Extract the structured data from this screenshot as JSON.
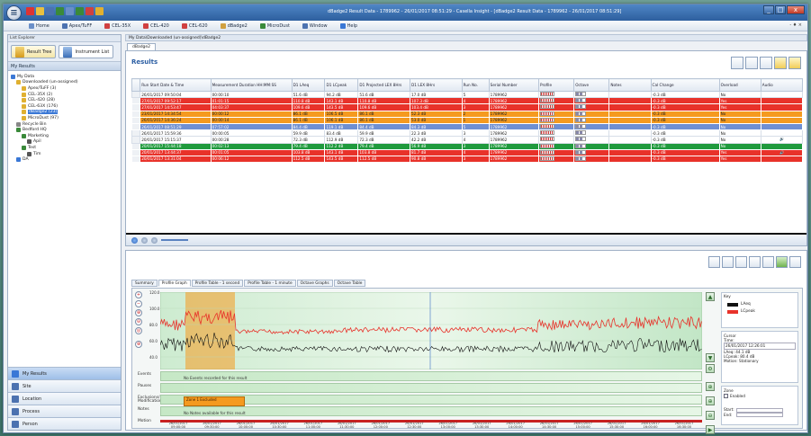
{
  "window": {
    "title": "dBadge2 Result Data - 1789962 - 26/01/2017 08:51:29 - Casella Insight - [dBadge2 Result Data - 1789962 - 26/01/2017 08:51:29]",
    "controls": [
      "_",
      "□",
      "x"
    ]
  },
  "menu": {
    "items": [
      {
        "label": "Home",
        "color": "#6a8fc8"
      },
      {
        "label": "Apex/TuFF",
        "color": "#4c72b0"
      },
      {
        "label": "CEL-35X",
        "color": "#d04040"
      },
      {
        "label": "CEL-420",
        "color": "#d04040"
      },
      {
        "label": "CEL-620",
        "color": "#d04040"
      },
      {
        "label": "dBadge2",
        "color": "#d0a040"
      },
      {
        "label": "MicroDust",
        "color": "#3a8a3a"
      },
      {
        "label": "Window",
        "color": "#4c72b0"
      },
      {
        "label": "Help",
        "color": "#3a78d6"
      }
    ],
    "right": "- ♦ ×"
  },
  "left": {
    "caption": "List Explorer",
    "tabs": [
      {
        "label": "Result Tree",
        "active": true
      },
      {
        "label": "Instrument List",
        "active": false
      }
    ],
    "section": "My Results",
    "tree": [
      {
        "label": "My Data",
        "indent": 0,
        "color": "#3a78d6"
      },
      {
        "label": "Downloaded (un-assigned)",
        "indent": 1,
        "color": "#e0b030"
      },
      {
        "label": "Apex/TuFF (3)",
        "indent": 2,
        "color": "#e0b030"
      },
      {
        "label": "CEL-35X (2)",
        "indent": 2,
        "color": "#e0b030"
      },
      {
        "label": "CEL-420 (28)",
        "indent": 2,
        "color": "#e0b030"
      },
      {
        "label": "CEL-63X (176)",
        "indent": 2,
        "color": "#e0b030"
      },
      {
        "label": "dBadge2 (23)",
        "indent": 2,
        "color": "#e0b030",
        "selected": true
      },
      {
        "label": "MicroDust (97)",
        "indent": 2,
        "color": "#e0b030"
      },
      {
        "label": "Recycle Bin",
        "indent": 1,
        "color": "#888888"
      },
      {
        "label": "Bedford HQ",
        "indent": 1,
        "color": "#3a8a3a"
      },
      {
        "label": "Marketing",
        "indent": 2,
        "color": "#3a8a3a"
      },
      {
        "label": "Apil",
        "indent": 3,
        "color": "#555555"
      },
      {
        "label": "Test",
        "indent": 2,
        "color": "#3a8a3a"
      },
      {
        "label": "Tim",
        "indent": 3,
        "color": "#555555"
      },
      {
        "label": "DA",
        "indent": 1,
        "color": "#3a78d6"
      }
    ],
    "nav": [
      {
        "label": "My Results",
        "active": true,
        "color": "#3a78d6"
      },
      {
        "label": "Site",
        "active": false,
        "color": "#4c72b0"
      },
      {
        "label": "Location",
        "active": false,
        "color": "#4c72b0"
      },
      {
        "label": "Process",
        "active": false,
        "color": "#4c72b0"
      },
      {
        "label": "Person",
        "active": false,
        "color": "#4c72b0"
      }
    ]
  },
  "main": {
    "path": "My Data\\Downloaded (un-assigned)\\dBadge2",
    "doc_tab": "dBadge2",
    "results_title": "Results",
    "columns": [
      "Run Start Date & Time",
      "Measurement Duration HH:MM:SS",
      "D1 LAeq",
      "D1 LCpeak",
      "D1 Projected LEX 8Hrs",
      "D1 LEX 8Hrs",
      "Run No.",
      "Serial Number",
      "Profile",
      "Octave",
      "Notes",
      "Cal Change",
      "Overload",
      "Audio"
    ],
    "rows": [
      {
        "c": "c-white",
        "cells": [
          "26/01/2017 09:50:04",
          "00:00:10",
          "51.6 dB",
          "94.2 dB",
          "51.6 dB",
          "17.0 dB",
          "5",
          "1789962",
          "",
          "",
          "",
          "-0.3 dB",
          "No",
          ""
        ]
      },
      {
        "c": "c-red",
        "cells": [
          "27/01/2017 09:52:17",
          "01:01:15",
          "110.8 dB",
          "143.1 dB",
          "110.8 dB",
          "107.3 dB",
          "4",
          "1789962",
          "",
          "",
          "",
          "-0.3 dB",
          "Yes",
          ""
        ]
      },
      {
        "c": "c-red",
        "cells": [
          "27/01/2017 14:53:47",
          "04:03:37",
          "109.6 dB",
          "143.5 dB",
          "109.6 dB",
          "103.4 dB",
          "3",
          "1789962",
          "",
          "",
          "",
          "-0.3 dB",
          "Yes",
          ""
        ]
      },
      {
        "c": "c-orange",
        "cells": [
          "23/01/2017 14:34:54",
          "00:00:12",
          "86.1 dB",
          "106.5 dB",
          "86.1 dB",
          "52.3 dB",
          "2",
          "1789962",
          "",
          "",
          "",
          "-0.3 dB",
          "No",
          ""
        ]
      },
      {
        "c": "c-orange",
        "cells": [
          "26/01/2017 14:36:24",
          "00:00:14",
          "86.1 dB",
          "106.1 dB",
          "86.1 dB",
          "53.0 dB",
          "1",
          "1789962",
          "",
          "",
          "",
          "-0.3 dB",
          "No",
          ""
        ]
      },
      {
        "c": "c-blue",
        "cells": [
          "26/01/2017 08:51:29",
          "07:57:02",
          "84.4 dB",
          "119.1 dB",
          "84.4 dB",
          "84.3 dB",
          "5",
          "1789962",
          "",
          "",
          "",
          "-0.3 dB",
          "No",
          ""
        ]
      },
      {
        "c": "c-white",
        "cells": [
          "26/01/2017 15:59:36",
          "00:00:05",
          "59.9 dB",
          "83.4 dB",
          "59.9 dB",
          "22.3 dB",
          "3",
          "1789962",
          "",
          "",
          "",
          "-0.3 dB",
          "No",
          ""
        ]
      },
      {
        "c": "c-white",
        "cells": [
          "20/01/2017 15:15:37",
          "00:00:28",
          "72.3 dB",
          "112.9 dB",
          "72.3 dB",
          "42.2 dB",
          "4",
          "1789962",
          "",
          "",
          "",
          "-0.3 dB",
          "No",
          "🔊"
        ]
      },
      {
        "c": "c-green",
        "cells": [
          "20/01/2017 15:44:18",
          "00:02:13",
          "79.4 dB",
          "112.2 dB",
          "79.4 dB",
          "56.9 dB",
          "3",
          "1789962",
          "",
          "",
          "",
          "-0.3 dB",
          "No",
          ""
        ]
      },
      {
        "c": "c-red",
        "cells": [
          "20/01/2017 13:44:37",
          "00:01:05",
          "103.8 dB",
          "143.1 dB",
          "103.8 dB",
          "81.7 dB",
          "4",
          "1789962",
          "",
          "",
          "",
          "-0.3 dB",
          "Yes",
          "🔊"
        ]
      },
      {
        "c": "c-red",
        "cells": [
          "20/01/2017 13:31:04",
          "00:06:12",
          "112.5 dB",
          "143.5 dB",
          "112.5 dB",
          "90.8 dB",
          "3",
          "1789962",
          "",
          "",
          "",
          "-0.3 dB",
          "Yes",
          ""
        ]
      }
    ],
    "lower": {
      "tabs": [
        "Summary",
        "Profile Graph",
        "Profile Table - 1 second",
        "Profile Table - 1 minute",
        "Octave Graphs",
        "Octave Table"
      ],
      "active_tab": 1,
      "y_ticks": [
        "120.0",
        "100.0",
        "80.0",
        "60.0",
        "40.0"
      ],
      "lanes": [
        {
          "label": "Events",
          "text": "No Events recorded for this result"
        },
        {
          "label": "Pauses",
          "text": ""
        },
        {
          "label": "Exclusions/ Modifications",
          "text": "Zone 1 Excluded"
        },
        {
          "label": "Notes",
          "text": "No Notes available for this result"
        },
        {
          "label": "Motion",
          "text": ""
        }
      ],
      "x_ticks": [
        {
          "d": "26/01/2017",
          "t": "09:00:00"
        },
        {
          "d": "26/01/2017",
          "t": "09:30:00"
        },
        {
          "d": "26/01/2017",
          "t": "10:00:00"
        },
        {
          "d": "26/01/2017",
          "t": "10:30:00"
        },
        {
          "d": "26/01/2017",
          "t": "11:00:00"
        },
        {
          "d": "26/01/2017",
          "t": "11:30:00"
        },
        {
          "d": "26/01/2017",
          "t": "12:00:00"
        },
        {
          "d": "26/01/2017",
          "t": "12:30:00"
        },
        {
          "d": "26/01/2017",
          "t": "13:00:00"
        },
        {
          "d": "26/01/2017",
          "t": "13:30:00"
        },
        {
          "d": "26/01/2017",
          "t": "14:00:00"
        },
        {
          "d": "26/01/2017",
          "t": "14:30:00"
        },
        {
          "d": "26/01/2017",
          "t": "15:00:00"
        },
        {
          "d": "26/01/2017",
          "t": "15:30:00"
        },
        {
          "d": "26/01/2017",
          "t": "16:00:00"
        },
        {
          "d": "26/01/2017",
          "t": "16:30:00"
        }
      ],
      "key": {
        "title": "Key",
        "items": [
          {
            "label": "LAeq",
            "color": "#111111"
          },
          {
            "label": "LCpeak",
            "color": "#e8322a"
          }
        ]
      },
      "cursor": {
        "title": "Cursor",
        "time_label": "Time:",
        "time": "26/01/2017 12:26:01",
        "laeq": "LAeq: 44.1 dB",
        "lcpeak": "LCpeak: 80.4 dB",
        "motion": "Motion: Stationary"
      },
      "zone": {
        "title": "Zone",
        "enabled": "Enabled",
        "start": "Start:",
        "end": "End:"
      }
    }
  }
}
